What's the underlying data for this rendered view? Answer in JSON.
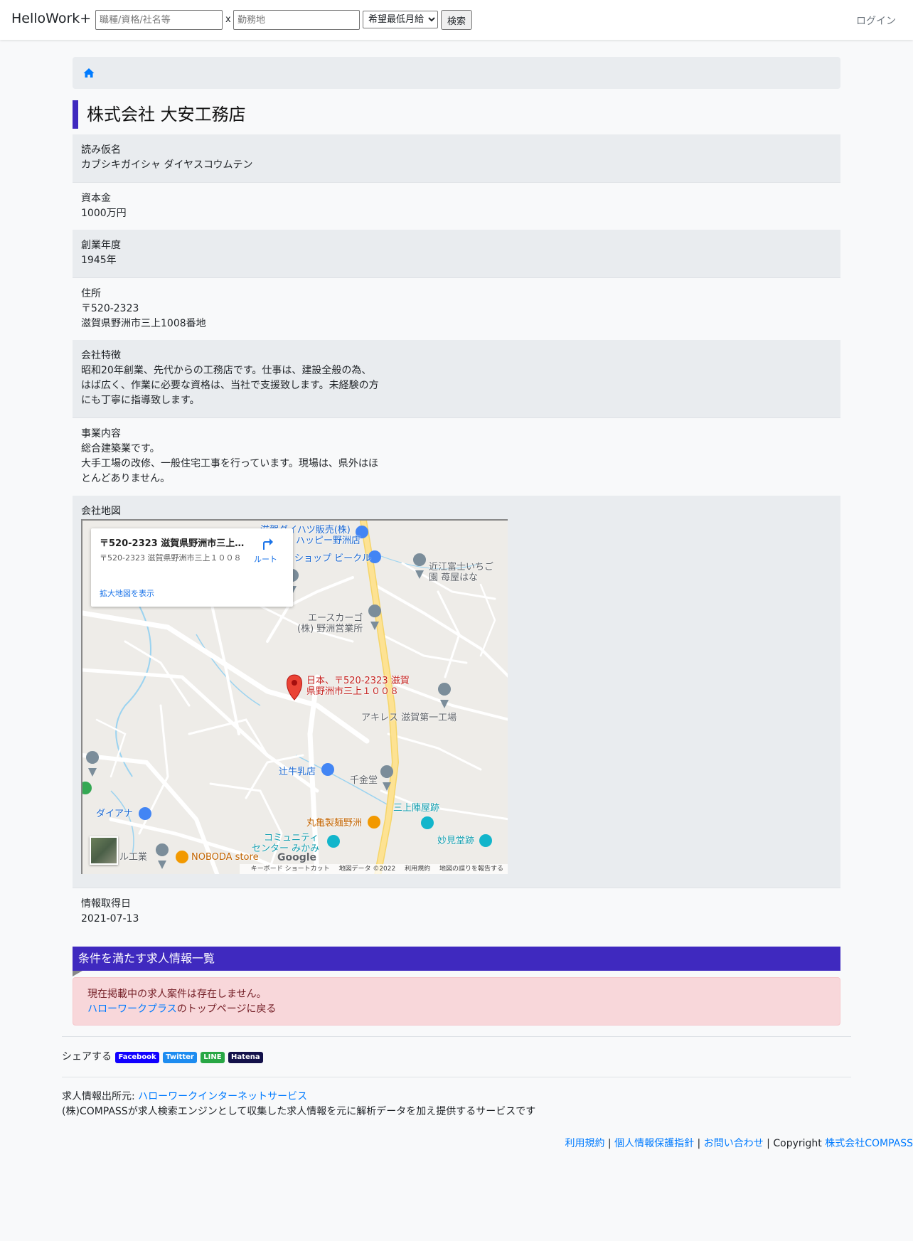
{
  "navbar": {
    "brand": "HelloWork+",
    "keyword_placeholder": "職種/資格/社名等",
    "separator": "x",
    "location_placeholder": "勤務地",
    "salary_select": "希望最低月給",
    "search_button": "検索",
    "login": "ログイン"
  },
  "company": {
    "name": "株式会社 大安工務店",
    "fields": [
      {
        "label": "読み仮名",
        "value": "カブシキガイシャ ダイヤスコウムテン"
      },
      {
        "label": "資本金",
        "value": "1000万円"
      },
      {
        "label": "創業年度",
        "value": "1945年"
      },
      {
        "label": "住所",
        "value": "〒520-2323\n滋賀県野洲市三上1008番地"
      },
      {
        "label": "会社特徴",
        "value": "昭和20年創業、先代からの工務店です。仕事は、建設全般の為、\nはば広く、作業に必要な資格は、当社で支援致します。未経験の方\nにも丁寧に指導致します。"
      },
      {
        "label": "事業内容",
        "value": "総合建築業です。\n大手工場の改修、一般住宅工事を行っています。現場は、県外はほ\nとんどありません。"
      },
      {
        "label": "会社地図",
        "value": ""
      },
      {
        "label": "情報取得日",
        "value": "2021-07-13"
      }
    ]
  },
  "map": {
    "card_title": "〒520-2323 滋賀県野洲市三上…",
    "card_address": "〒520-2323 滋賀県野洲市三上１００８",
    "card_link": "拡大地図を表示",
    "route_label": "ルート",
    "marker_label_1": "日本、〒520-2323 滋賀",
    "marker_label_2": "県野洲市三上１００８",
    "pois": {
      "daihatsu_1": "滋賀ダイハツ販売(株)",
      "daihatsu_2": "ハッピー野洲店",
      "vehicle": "ショップ ビークル",
      "ichigo_1": "近江富士いちご",
      "ichigo_2": "園 苺屋はな",
      "acecargo_1": "エースカーゴ",
      "acecargo_2": "(株) 野洲営業所",
      "achilles": "アキレス 滋賀第一工場",
      "tsujiushi": "辻牛乳店",
      "sengando": "千金堂",
      "mikami": "三上陣屋跡",
      "marugame": "丸亀製麺野洲",
      "community_1": "コミュニティ",
      "community_2": "センター みかみ",
      "myokendo": "妙見堂跡",
      "diana": "ダイアナ",
      "nakamura": "ル工業",
      "noboda": "NOBODA store"
    },
    "google": "Google",
    "footer_shortcuts": "キーボード ショートカット",
    "footer_data": "地図データ ©2022",
    "footer_terms": "利用規約",
    "footer_report": "地図の誤りを報告する",
    "colors": {
      "marker": "#ea4335",
      "highway": "#fde293",
      "road": "#ffffff",
      "water": "#9bd3f0"
    }
  },
  "jobs": {
    "header": "条件を満たす求人情報一覧",
    "empty_message": "現在掲載中の求人案件は存在しません。",
    "back_link": "ハローワークプラス",
    "back_suffix": "のトップページに戻る"
  },
  "share": {
    "label": "シェアする",
    "facebook": "Facebook",
    "twitter": "Twitter",
    "line": "LINE",
    "hatena": "Hatena"
  },
  "source": {
    "prefix": "求人情報出所元: ",
    "link": "ハローワークインターネットサービス",
    "description": "(株)COMPASSが求人検索エンジンとして収集した求人情報を元に解析データを加え提供するサービスです"
  },
  "footer": {
    "terms": "利用規約",
    "privacy": "個人情報保護指針",
    "contact": "お問い合わせ",
    "copyright": "Copyright ",
    "company": "株式会社COMPASS",
    "sep": " | "
  },
  "theme": {
    "accent": "#3f29bf",
    "link": "#007bff",
    "alert_bg": "#f8d7da"
  }
}
